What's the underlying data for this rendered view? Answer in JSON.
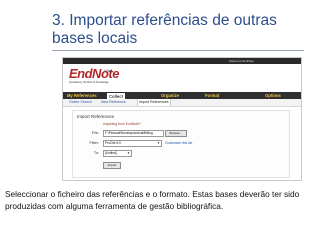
{
  "slide": {
    "title": "3. Importar referências de outras bases locais",
    "caption": "Seleccionar o ficheiro das referências e o formato. Estas bases deverão ter sido produzidas com alguma ferramenta de gestão bibliográfica."
  },
  "app": {
    "logo_main": "EndNote",
    "logo_web": "Web",
    "logo_sub": "provided by ISI Web of Knowledge",
    "topbar_link": "Welcome EndNote",
    "nav_tabs": [
      "My References",
      "Collect",
      "Organize",
      "Format",
      "Options"
    ],
    "sub_tabs": [
      "Online Search",
      "New Reference",
      "Import References"
    ],
    "panel_title": "Import References",
    "importing_from": "Importing from EndNote?",
    "file_label": "File:",
    "file_value": "F:\\Pessoal\\Nova\\apoioAvaliBiblog",
    "browse_label": "Browse...",
    "filter_label": "Filter:",
    "filter_value": "ProCite 5.0",
    "customize_link": "Customize this list",
    "to_label": "To:",
    "to_value": "[Unfiled]",
    "import_label": "Import"
  },
  "colors": {
    "title": "#2c4e8c",
    "logo": "#b3262a",
    "nav_bar": "#2f2f2f",
    "nav_text": "#f2c23b",
    "link": "#2a56a4"
  }
}
